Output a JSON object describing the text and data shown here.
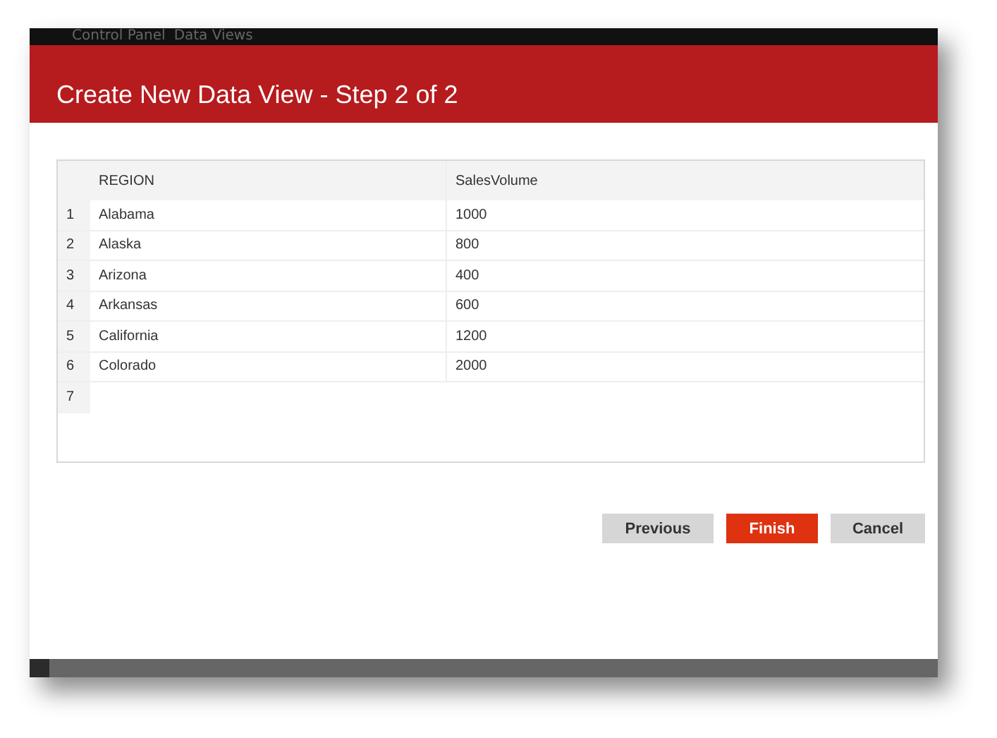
{
  "background_window": {
    "title": "Control Panel",
    "subtitle": "Data Views"
  },
  "dialog": {
    "title": "Create New Data View - Step 2 of 2"
  },
  "table": {
    "columns": [
      "REGION",
      "SalesVolume"
    ],
    "rows": [
      {
        "index": "1",
        "cells": [
          "Alabama",
          "1000"
        ]
      },
      {
        "index": "2",
        "cells": [
          "Alaska",
          "800"
        ]
      },
      {
        "index": "3",
        "cells": [
          "Arizona",
          "400"
        ]
      },
      {
        "index": "4",
        "cells": [
          "Arkansas",
          "600"
        ]
      },
      {
        "index": "5",
        "cells": [
          "California",
          "1200"
        ]
      },
      {
        "index": "6",
        "cells": [
          "Colorado",
          "2000"
        ]
      }
    ],
    "new_row_index": "7"
  },
  "buttons": [
    {
      "label": "Previous",
      "kind": "secondary"
    },
    {
      "label": "Finish",
      "kind": "primary"
    },
    {
      "label": "Cancel",
      "kind": "secondary"
    }
  ]
}
